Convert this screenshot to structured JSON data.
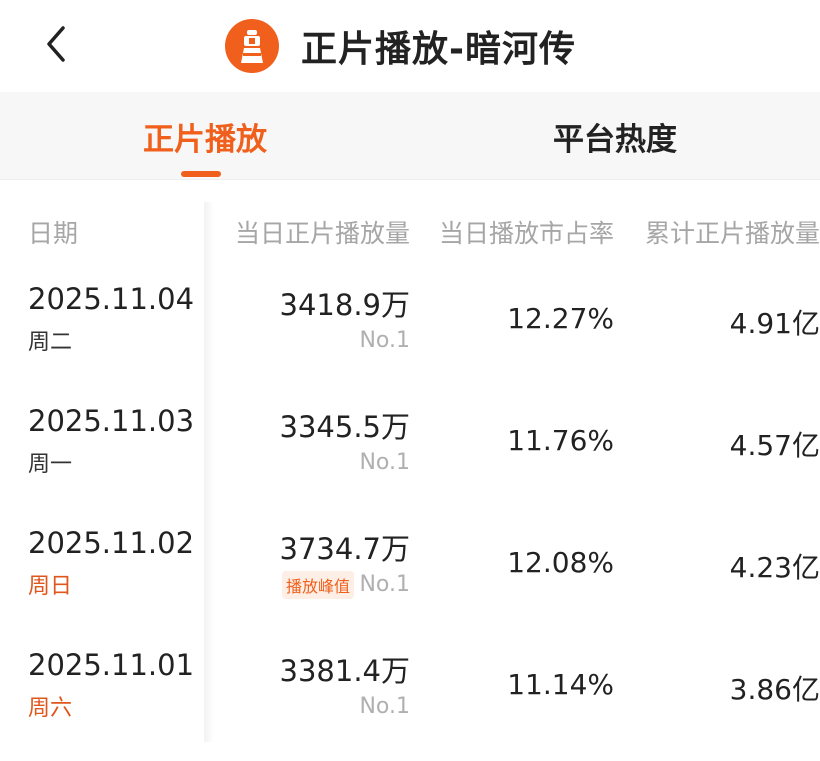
{
  "header": {
    "title": "正片播放-暗河传"
  },
  "tabs": [
    {
      "label": "正片播放",
      "active": true
    },
    {
      "label": "平台热度",
      "active": false
    }
  ],
  "table": {
    "columns": [
      "日期",
      "当日正片播放量",
      "当日播放市占率",
      "累计正片播放量"
    ],
    "rows": [
      {
        "date": "2025.11.04",
        "weekday": "周二",
        "plays": "3418.9万",
        "rank": "No.1",
        "share": "12.27%",
        "total": "4.91亿"
      },
      {
        "date": "2025.11.03",
        "weekday": "周一",
        "plays": "3345.5万",
        "rank": "No.1",
        "share": "11.76%",
        "total": "4.57亿"
      },
      {
        "date": "2025.11.02",
        "weekday": "周日",
        "plays": "3734.7万",
        "tag": "播放峰值",
        "rank": "No.1",
        "share": "12.08%",
        "total": "4.23亿"
      },
      {
        "date": "2025.11.01",
        "weekday": "周六",
        "plays": "3381.4万",
        "rank": "No.1",
        "share": "11.14%",
        "total": "3.86亿"
      }
    ]
  },
  "colors": {
    "accent": "#f0601c",
    "weekend": "#e0571c",
    "muted": "#a6a6a6"
  },
  "icons": {
    "back": "chevron-left-icon",
    "logo": "lighthouse-logo-icon"
  }
}
